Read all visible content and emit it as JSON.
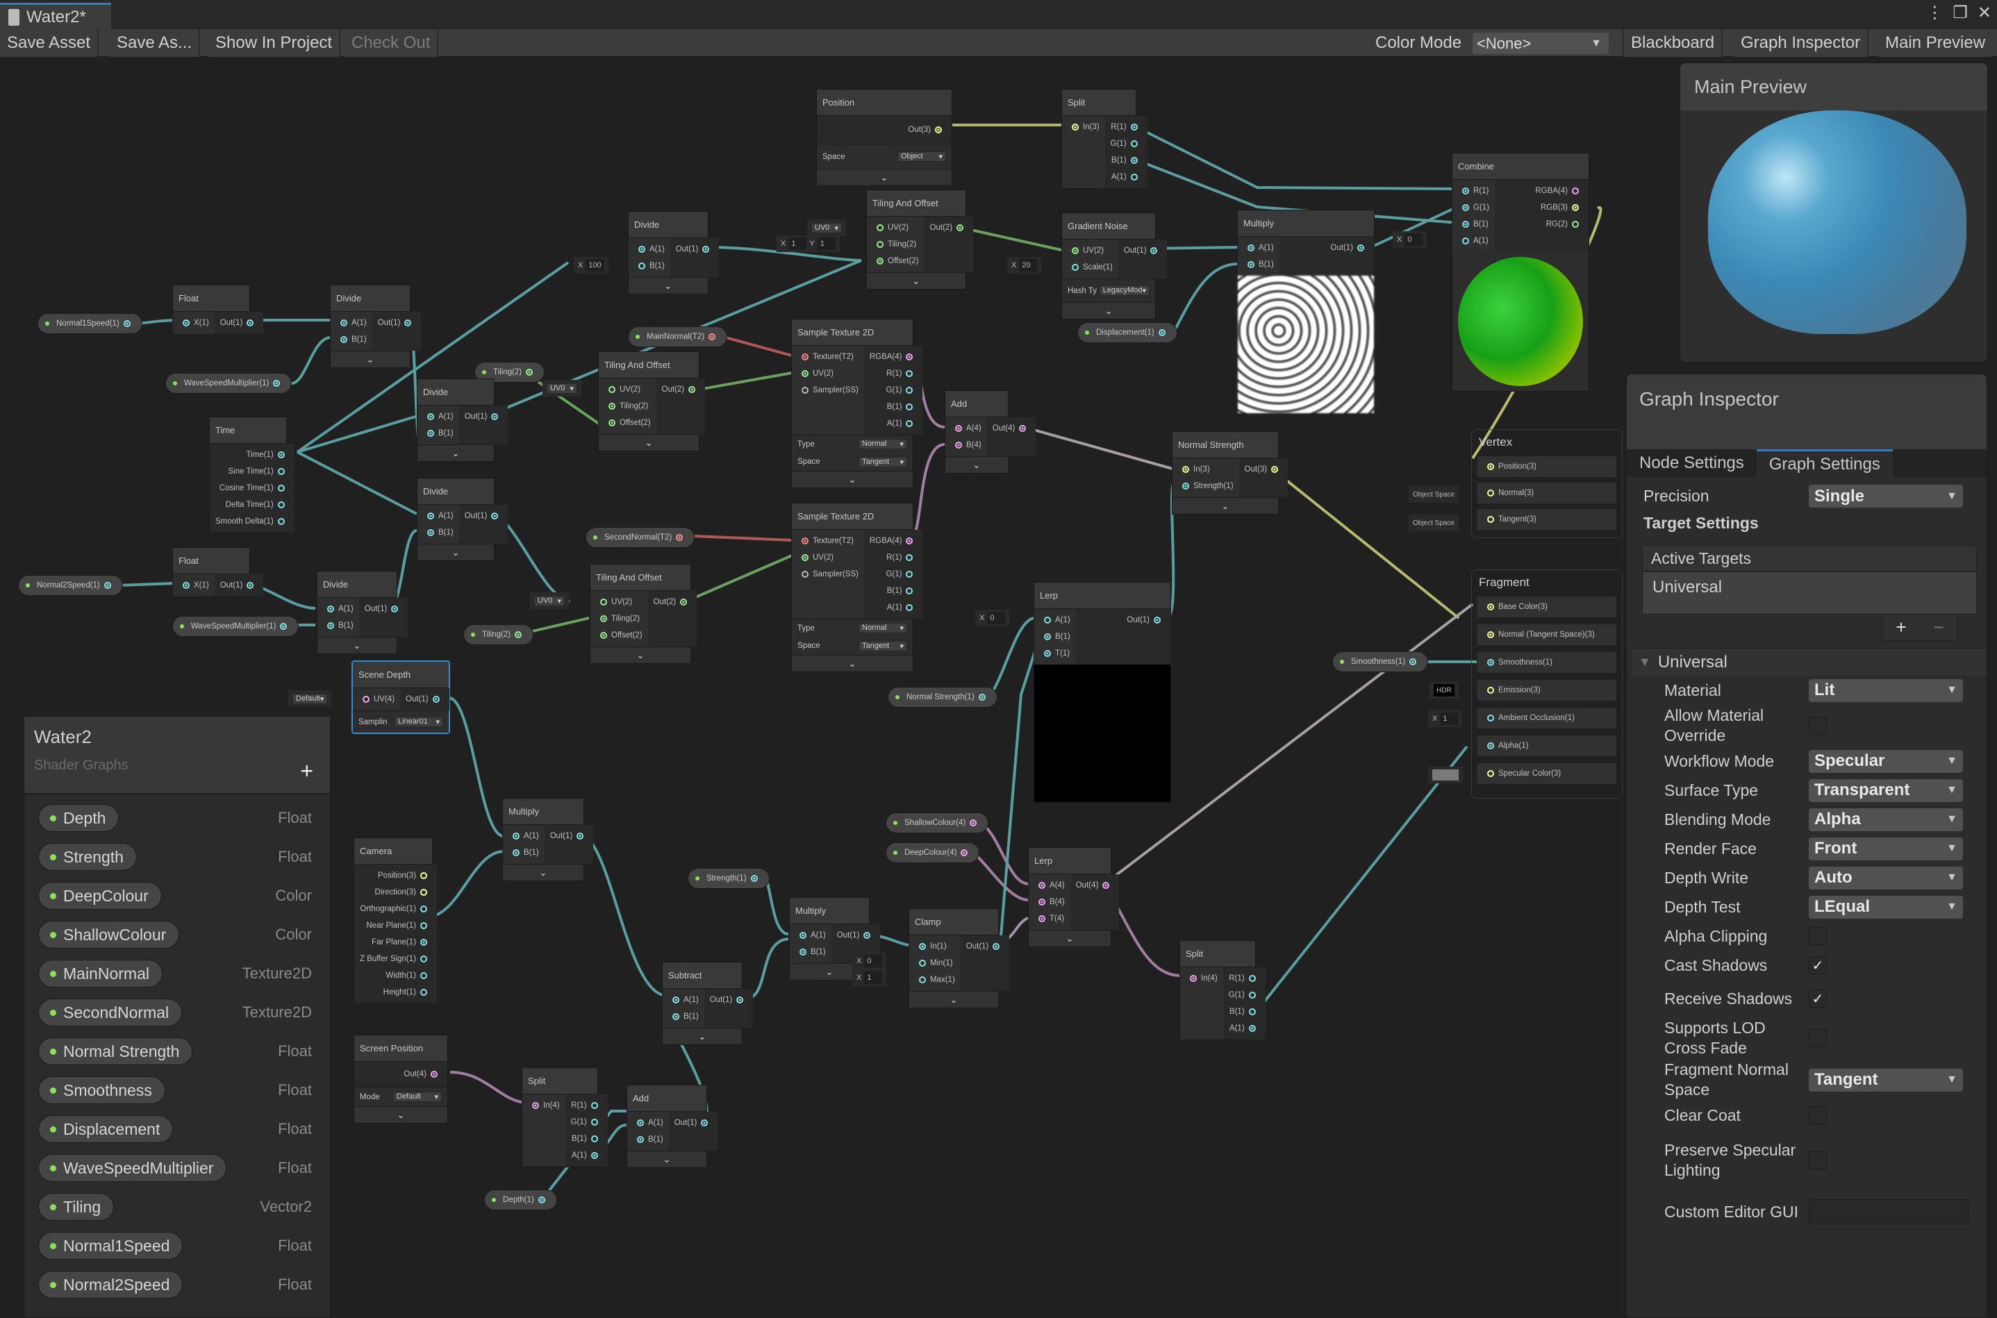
{
  "window": {
    "tab_title": "Water2*",
    "controls": [
      "more-icon",
      "maximize-icon",
      "close-icon"
    ]
  },
  "toolbar": {
    "save_asset": "Save Asset",
    "save_as": "Save As...",
    "show_in_project": "Show In Project",
    "check_out": "Check Out",
    "color_mode_label": "Color Mode",
    "color_mode_value": "<None>",
    "blackboard": "Blackboard",
    "graph_inspector": "Graph Inspector",
    "main_preview": "Main Preview"
  },
  "blackboard": {
    "title": "Water2",
    "subtitle": "Shader Graphs",
    "add": "+",
    "properties": [
      {
        "name": "Depth",
        "type": "Float"
      },
      {
        "name": "Strength",
        "type": "Float"
      },
      {
        "name": "DeepColour",
        "type": "Color"
      },
      {
        "name": "ShallowColour",
        "type": "Color"
      },
      {
        "name": "MainNormal",
        "type": "Texture2D"
      },
      {
        "name": "SecondNormal",
        "type": "Texture2D"
      },
      {
        "name": "Normal Strength",
        "type": "Float"
      },
      {
        "name": "Smoothness",
        "type": "Float"
      },
      {
        "name": "Displacement",
        "type": "Float"
      },
      {
        "name": "WaveSpeedMultiplier",
        "type": "Float"
      },
      {
        "name": "Tiling",
        "type": "Vector2"
      },
      {
        "name": "Normal1Speed",
        "type": "Float"
      },
      {
        "name": "Normal2Speed",
        "type": "Float"
      }
    ]
  },
  "main_preview": {
    "title": "Main Preview"
  },
  "inspector": {
    "title": "Graph Inspector",
    "tabs": [
      "Node Settings",
      "Graph Settings"
    ],
    "active_tab": "Graph Settings",
    "precision_label": "Precision",
    "precision_value": "Single",
    "target_settings": "Target Settings",
    "active_targets_header": "Active Targets",
    "active_targets": [
      "Universal"
    ],
    "list_add": "+",
    "list_remove": "−",
    "section": "Universal",
    "fields": [
      {
        "label": "Material",
        "kind": "select",
        "value": "Lit"
      },
      {
        "label": "Allow Material Override",
        "kind": "check",
        "value": false
      },
      {
        "label": "Workflow Mode",
        "kind": "select",
        "value": "Specular"
      },
      {
        "label": "Surface Type",
        "kind": "select",
        "value": "Transparent"
      },
      {
        "label": "Blending Mode",
        "kind": "select",
        "value": "Alpha"
      },
      {
        "label": "Render Face",
        "kind": "select",
        "value": "Front"
      },
      {
        "label": "Depth Write",
        "kind": "select",
        "value": "Auto"
      },
      {
        "label": "Depth Test",
        "kind": "select",
        "value": "LEqual"
      },
      {
        "label": "Alpha Clipping",
        "kind": "check",
        "value": false
      },
      {
        "label": "Cast Shadows",
        "kind": "check",
        "value": true
      },
      {
        "label": "Receive Shadows",
        "kind": "check",
        "value": true
      },
      {
        "label": "Supports LOD Cross Fade",
        "kind": "check",
        "value": false
      },
      {
        "label": "Fragment Normal Space",
        "kind": "select",
        "value": "Tangent"
      },
      {
        "label": "Clear Coat",
        "kind": "check",
        "value": false
      },
      {
        "label": "Preserve Specular Lighting",
        "kind": "check",
        "value": false
      },
      {
        "label": "Custom Editor GUI",
        "kind": "text",
        "value": ""
      }
    ]
  },
  "graph": {
    "props": {
      "normal1speed": "Normal1Speed(1)",
      "wsm1": "WaveSpeedMultiplier(1)",
      "wsm2": "WaveSpeedMultiplier(1)",
      "normal2speed": "Normal2Speed(1)",
      "tiling1": "Tiling(2)",
      "tiling2": "Tiling(2)",
      "mainnormal": "MainNormal(T2)",
      "secondnormal": "SecondNormal(T2)",
      "displacement": "Displacement(1)",
      "normalstrength": "Normal Strength(1)",
      "smoothness": "Smoothness(1)",
      "shallow": "ShallowColour(4)",
      "deep": "DeepColour(4)",
      "strength": "Strength(1)",
      "depth": "Depth(1)"
    },
    "nodes": {
      "float1": {
        "title": "Float",
        "ins": [
          "X(1)"
        ],
        "outs": [
          "Out(1)"
        ]
      },
      "divide1": {
        "title": "Divide",
        "ins": [
          "A(1)",
          "B(1)"
        ],
        "outs": [
          "Out(1)"
        ]
      },
      "time": {
        "title": "Time",
        "outs": [
          "Time(1)",
          "Sine Time(1)",
          "Cosine Time(1)",
          "Delta Time(1)",
          "Smooth Delta(1)"
        ]
      },
      "divide2": {
        "title": "Divide",
        "ins": [
          "A(1)",
          "B(1)"
        ],
        "outs": [
          "Out(1)"
        ]
      },
      "divide3": {
        "title": "Divide",
        "ins": [
          "A(1)",
          "B(1)"
        ],
        "outs": [
          "Out(1)"
        ]
      },
      "float2": {
        "title": "Float",
        "ins": [
          "X(1)"
        ],
        "outs": [
          "Out(1)"
        ]
      },
      "divide4": {
        "title": "Divide",
        "ins": [
          "A(1)",
          "B(1)"
        ],
        "outs": [
          "Out(1)"
        ]
      },
      "divide5": {
        "title": "Divide",
        "ins": [
          "A(1)",
          "B(1)"
        ],
        "outs": [
          "Out(1)"
        ],
        "b_value": "100"
      },
      "position": {
        "title": "Position",
        "outs": [
          "Out(3)"
        ],
        "space_label": "Space",
        "space_value": "Object"
      },
      "split1": {
        "title": "Split",
        "ins": [
          "In(3)"
        ],
        "outs": [
          "R(1)",
          "G(1)",
          "B(1)",
          "A(1)"
        ]
      },
      "tao1": {
        "title": "Tiling And Offset",
        "ins": [
          "UV(2)",
          "Tiling(2)",
          "Offset(2)"
        ],
        "outs": [
          "Out(2)"
        ],
        "uv": "UV0",
        "tx": "1",
        "ty": "1"
      },
      "gradnoise": {
        "title": "Gradient Noise",
        "ins": [
          "UV(2)",
          "Scale(1)"
        ],
        "outs": [
          "Out(1)"
        ],
        "scale": "20",
        "hash_label": "Hash Ty",
        "hash_value": "LegacyMod"
      },
      "multiply1": {
        "title": "Multiply",
        "ins": [
          "A(1)",
          "B(1)"
        ],
        "outs": [
          "Out(1)"
        ]
      },
      "combine": {
        "title": "Combine",
        "ins": [
          "R(1)",
          "G(1)",
          "B(1)",
          "A(1)"
        ],
        "outs": [
          "RGBA(4)",
          "RGB(3)",
          "RG(2)"
        ],
        "a_value": "0"
      },
      "tao2": {
        "title": "Tiling And Offset",
        "ins": [
          "UV(2)",
          "Tiling(2)",
          "Offset(2)"
        ],
        "outs": [
          "Out(2)"
        ],
        "uv": "UV0"
      },
      "st1": {
        "title": "Sample Texture 2D",
        "ins": [
          "Texture(T2)",
          "UV(2)",
          "Sampler(SS)"
        ],
        "outs": [
          "RGBA(4)",
          "R(1)",
          "G(1)",
          "B(1)",
          "A(1)"
        ],
        "type_label": "Type",
        "type_value": "Normal",
        "space_label": "Space",
        "space_value": "Tangent"
      },
      "st2": {
        "title": "Sample Texture 2D",
        "ins": [
          "Texture(T2)",
          "UV(2)",
          "Sampler(SS)"
        ],
        "outs": [
          "RGBA(4)",
          "R(1)",
          "G(1)",
          "B(1)",
          "A(1)"
        ],
        "type_label": "Type",
        "type_value": "Normal",
        "space_label": "Space",
        "space_value": "Tangent"
      },
      "tao3": {
        "title": "Tiling And Offset",
        "ins": [
          "UV(2)",
          "Tiling(2)",
          "Offset(2)"
        ],
        "outs": [
          "Out(2)"
        ],
        "uv": "UV0"
      },
      "add1": {
        "title": "Add",
        "ins": [
          "A(4)",
          "B(4)"
        ],
        "outs": [
          "Out(4)"
        ]
      },
      "normstr": {
        "title": "Normal Strength",
        "ins": [
          "In(3)",
          "Strength(1)"
        ],
        "outs": [
          "Out(3)"
        ]
      },
      "lerp1": {
        "title": "Lerp",
        "ins": [
          "A(1)",
          "B(1)",
          "T(1)"
        ],
        "outs": [
          "Out(1)"
        ],
        "a_value": "0"
      },
      "scenedepth": {
        "title": "Scene Depth",
        "ins": [
          "UV(4)"
        ],
        "outs": [
          "Out(1)"
        ],
        "uv_value": "Default",
        "sampling_label": "Samplin",
        "sampling_value": "Linear01"
      },
      "camera": {
        "title": "Camera",
        "outs": [
          "Position(3)",
          "Direction(3)",
          "Orthographic(1)",
          "Near Plane(1)",
          "Far Plane(1)",
          "Z Buffer Sign(1)",
          "Width(1)",
          "Height(1)"
        ]
      },
      "multiply2": {
        "title": "Multiply",
        "ins": [
          "A(1)",
          "B(1)"
        ],
        "outs": [
          "Out(1)"
        ]
      },
      "screenpos": {
        "title": "Screen Position",
        "outs": [
          "Out(4)"
        ],
        "mode_label": "Mode",
        "mode_value": "Default"
      },
      "split2": {
        "title": "Split",
        "ins": [
          "In(4)"
        ],
        "outs": [
          "R(1)",
          "G(1)",
          "B(1)",
          "A(1)"
        ]
      },
      "add2": {
        "title": "Add",
        "ins": [
          "A(1)",
          "B(1)"
        ],
        "outs": [
          "Out(1)"
        ]
      },
      "subtract": {
        "title": "Subtract",
        "ins": [
          "A(1)",
          "B(1)"
        ],
        "outs": [
          "Out(1)"
        ]
      },
      "multiply3": {
        "title": "Multiply",
        "ins": [
          "A(1)",
          "B(1)"
        ],
        "outs": [
          "Out(1)"
        ]
      },
      "clamp": {
        "title": "Clamp",
        "ins": [
          "In(1)",
          "Min(1)",
          "Max(1)"
        ],
        "outs": [
          "Out(1)"
        ],
        "min": "0",
        "max": "1"
      },
      "lerp2": {
        "title": "Lerp",
        "ins": [
          "A(4)",
          "B(4)",
          "T(4)"
        ],
        "outs": [
          "Out(4)"
        ]
      },
      "split3": {
        "title": "Split",
        "ins": [
          "In(4)"
        ],
        "outs": [
          "R(1)",
          "G(1)",
          "B(1)",
          "A(1)"
        ]
      }
    },
    "vertex": {
      "title": "Vertex",
      "slots": [
        "Position(3)",
        "Normal(3)",
        "Tangent(3)"
      ],
      "normal_default": "Object Space",
      "tangent_default": "Object Space"
    },
    "fragment": {
      "title": "Fragment",
      "slots": [
        "Base Color(3)",
        "Normal (Tangent Space)(3)",
        "Smoothness(1)",
        "Emission(3)",
        "Ambient Occlusion(1)",
        "Alpha(1)",
        "Specular Color(3)"
      ],
      "emission_default": "HDR",
      "ao_default": "1"
    }
  }
}
